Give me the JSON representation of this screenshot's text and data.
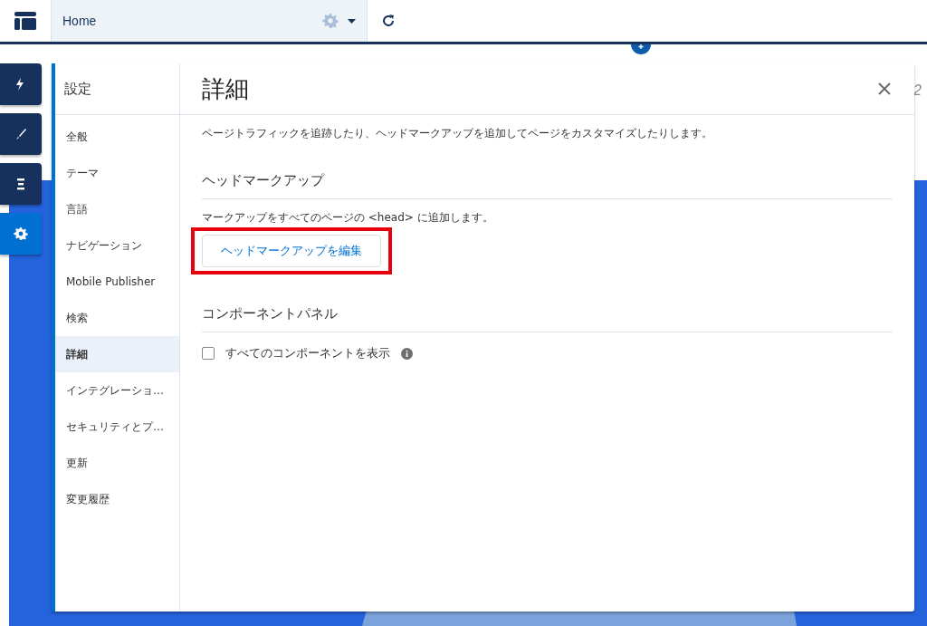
{
  "topbar": {
    "page": "Home"
  },
  "canvas": {
    "corner_text": "2"
  },
  "tools": [
    {
      "kind": "bolt",
      "selected": false
    },
    {
      "kind": "brush",
      "selected": false
    },
    {
      "kind": "list",
      "selected": false
    },
    {
      "kind": "gear",
      "selected": true
    }
  ],
  "settings": {
    "title": "設定",
    "sidebar": [
      {
        "label": "全般",
        "selected": false
      },
      {
        "label": "テーマ",
        "selected": false
      },
      {
        "label": "言語",
        "selected": false
      },
      {
        "label": "ナビゲーション",
        "selected": false
      },
      {
        "label": "Mobile Publisher",
        "selected": false
      },
      {
        "label": "検索",
        "selected": false
      },
      {
        "label": "詳細",
        "selected": true
      },
      {
        "label": "インテグレーショ…",
        "selected": false
      },
      {
        "label": "セキュリティとプ…",
        "selected": false
      },
      {
        "label": "更新",
        "selected": false
      },
      {
        "label": "変更履歴",
        "selected": false
      }
    ],
    "heading": "詳細",
    "description": "ページトラフィックを追跡したり、ヘッドマークアップを追加してページをカスタマイズしたりします。",
    "sections": [
      {
        "title": "ヘッドマークアップ",
        "kind": "button",
        "text": "マークアップをすべてのページの <head> に追加します。",
        "button": "ヘッドマークアップを編集",
        "highlighted": true
      },
      {
        "title": "コンポーネントパネル",
        "kind": "checkbox",
        "label": "すべてのコンポーネントを表示",
        "checked": false
      }
    ]
  }
}
